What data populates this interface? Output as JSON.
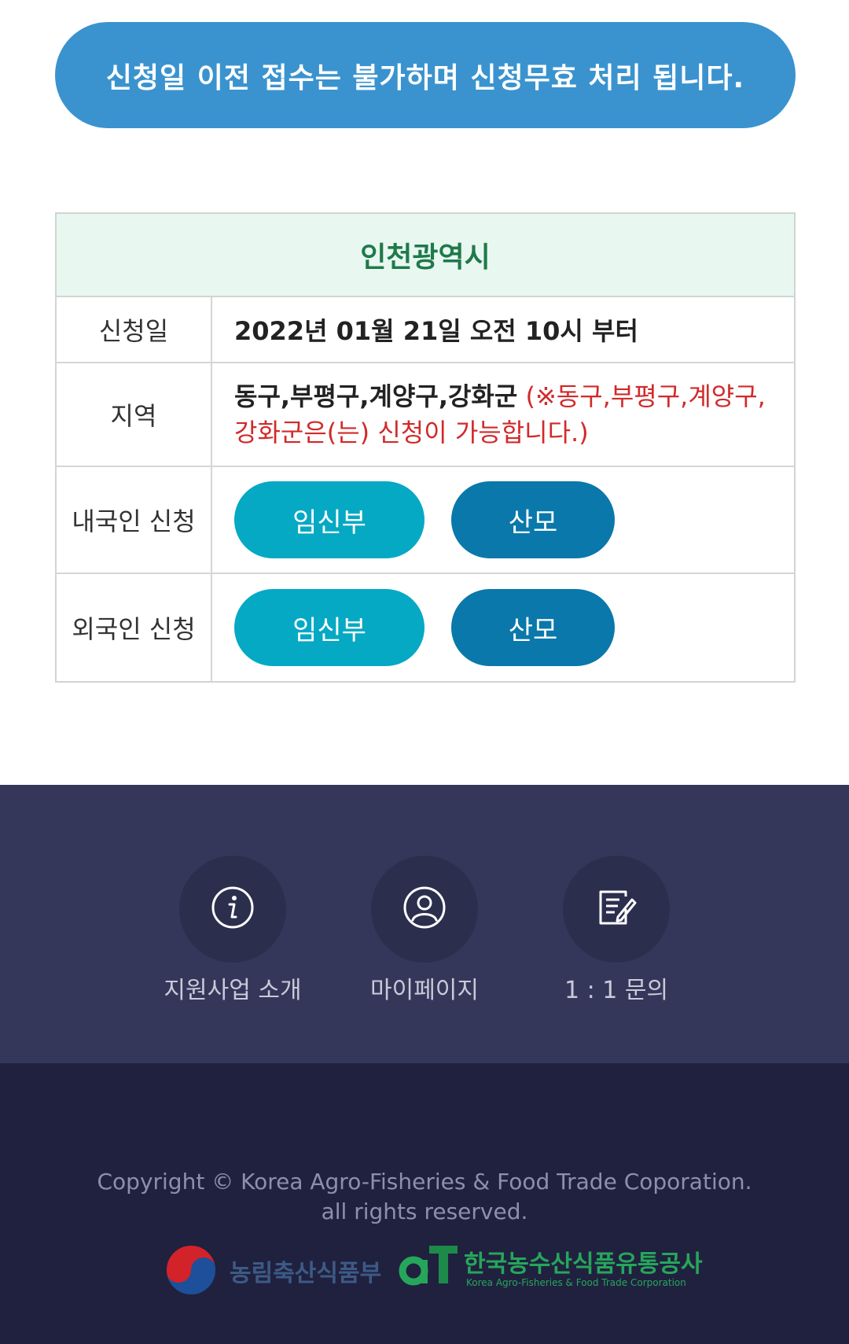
{
  "notice": {
    "text": "신청일 이전 접수는 불가하며 신청무효 처리 됩니다."
  },
  "table": {
    "title": "인천광역시",
    "rows": {
      "date": {
        "label": "신청일",
        "value": "2022년 01월 21일 오전 10시 부터"
      },
      "area": {
        "label": "지역",
        "value": "동구,부평구,계양구,강화군",
        "note": "(※동구,부평구,계양구,강화군은(는) 신청이 가능합니다.)"
      },
      "domestic": {
        "label": "내국인 신청",
        "btn_pregnant": "임신부",
        "btn_mother": "산모"
      },
      "foreign": {
        "label": "외국인 신청",
        "btn_pregnant": "임신부",
        "btn_mother": "산모"
      }
    }
  },
  "footer": {
    "menu": [
      {
        "label": "지원사업 소개",
        "icon": "info-icon"
      },
      {
        "label": "마이페이지",
        "icon": "user-icon"
      },
      {
        "label": "1 : 1 문의",
        "icon": "edit-document-icon"
      }
    ],
    "copyright_line1": "Copyright © Korea Agro-Fisheries & Food Trade Coporation.",
    "copyright_line2": "all rights reserved.",
    "logos": {
      "ministry": "농림축산식품부",
      "at_name": "한국농수산식품유통공사",
      "at_sub": "Korea Agro-Fisheries & Food Trade Corporation"
    }
  },
  "colors": {
    "notice_bg": "#3a93cf",
    "table_head_bg": "#e9f7f1",
    "table_head_text": "#1e7a4a",
    "note_red": "#d12a2a",
    "btn_pregnant": "#05a9c4",
    "btn_mother": "#0a78aa",
    "footer_top": "#35375a",
    "footer_bottom": "#20213f"
  }
}
